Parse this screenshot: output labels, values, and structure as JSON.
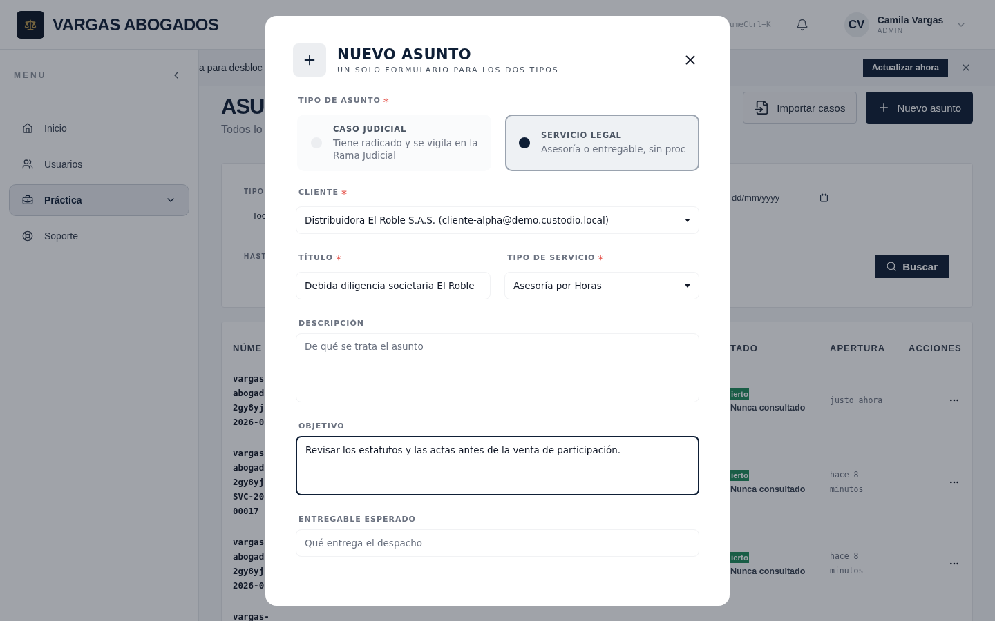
{
  "header": {
    "brand": "VARGAS ABOGADOS",
    "search_hint": "ume",
    "search_shortcut": "Ctrl+K",
    "user": {
      "initials": "CV",
      "name": "Camila Vargas",
      "role": "ADMIN"
    }
  },
  "sidebar": {
    "title": "MENU",
    "items": [
      {
        "label": "Inicio",
        "selected": false,
        "expandable": false
      },
      {
        "label": "Usuarios",
        "selected": false,
        "expandable": false
      },
      {
        "label": "Práctica",
        "selected": true,
        "expandable": true
      },
      {
        "label": "Soporte",
        "selected": false,
        "expandable": false
      }
    ]
  },
  "banner": {
    "text": "a para desbloc",
    "action": "Actualizar ahora"
  },
  "page": {
    "title": "ASU",
    "subtitle": "Todos lo",
    "buttons": [
      {
        "label": "Importar casos",
        "kind": "secondary"
      },
      {
        "label": "Nuevo asunto",
        "kind": "primary"
      }
    ]
  },
  "filters": {
    "type_label": "TIPO",
    "type_value": "Toc",
    "until_label": "HAST",
    "date_placeholder": "dd/mm/yyyy",
    "search_button": "Buscar"
  },
  "table": {
    "columns": [
      "NÚME",
      "TADO",
      "APERTURA",
      "ACCIONES"
    ],
    "rows": [
      {
        "number": [
          "vargas",
          "abogad",
          "2gy8yj",
          "2026-0"
        ],
        "status": "ierto",
        "consulted": "Nunca consultado",
        "opened": "justo ahora"
      },
      {
        "number": [
          "vargas",
          "abogad",
          "2gy8yj",
          "SVC-20",
          "00017"
        ],
        "status": "ierto",
        "consulted": "Nunca consultado",
        "opened": "hace 8 minutos"
      },
      {
        "number": [
          "vargas",
          "abogad",
          "2gy8yj",
          "2026-0"
        ],
        "status": "ierto",
        "consulted": "Nunca consultado",
        "opened": "hace 8 minutos"
      },
      {
        "number": [
          "vargas-"
        ]
      }
    ]
  },
  "modal": {
    "title": "NUEVO ASUNTO",
    "subtitle": "UN SOLO FORMULARIO PARA LOS DOS TIPOS",
    "type_label": "TIPO DE ASUNTO",
    "type_mark": "*",
    "types": [
      {
        "title": "CASO JUDICIAL",
        "description": "Tiene radicado y se vigila en la Rama Judicial",
        "selected": false
      },
      {
        "title": "SERVICIO LEGAL",
        "description": "Asesoría o entregable, sin proc",
        "selected": true
      }
    ],
    "field_rows": [
      {
        "fields": [
          {
            "label": "CLIENTE",
            "mark": "*",
            "kind": "select",
            "value": "Distribuidora El Roble S.A.S. (cliente-alpha@demo.custodio.local)",
            "focused": false
          }
        ]
      },
      {
        "fields": [
          {
            "label": "TÍTULO",
            "mark": "*",
            "kind": "input",
            "value": "Debida diligencia societaria El Roble",
            "focused": false
          },
          {
            "label": "TIPO DE SERVICIO",
            "mark": "*",
            "kind": "select",
            "value": "Asesoría por Horas",
            "focused": false
          }
        ]
      },
      {
        "fields": [
          {
            "label": "DESCRIPCIÓN",
            "kind": "textarea",
            "placeholder": "De qué se trata el asunto",
            "focused": false
          }
        ]
      },
      {
        "fields": [
          {
            "label": "OBJETIVO",
            "kind": "textarea",
            "value": "Revisar los estatutos y las actas antes de la venta de participación.",
            "focused": true
          }
        ]
      },
      {
        "fields": [
          {
            "label": "ENTREGABLE ESPERADO",
            "kind": "input",
            "placeholder": "Qué entrega el despacho",
            "focused": false
          }
        ]
      }
    ]
  }
}
